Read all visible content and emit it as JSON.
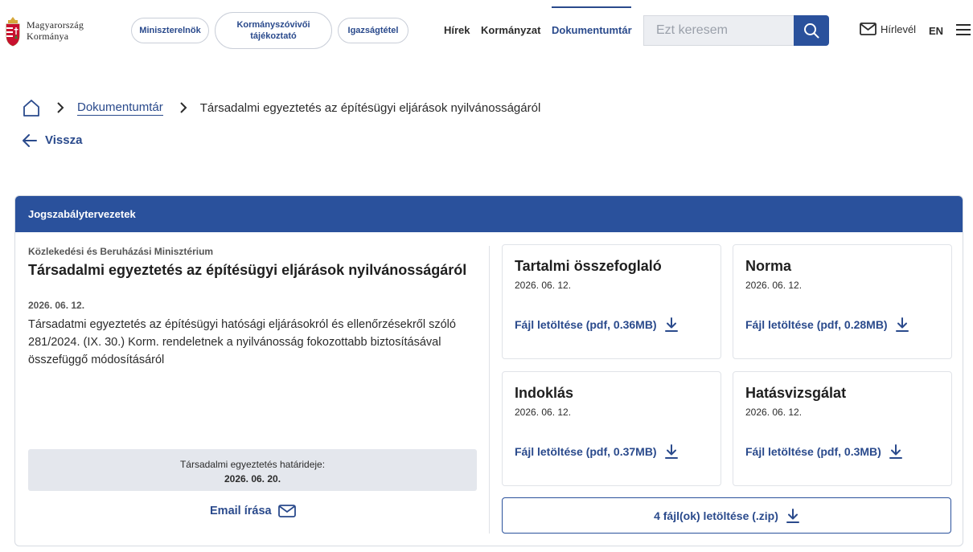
{
  "header": {
    "logo": {
      "line1": "Magyarország",
      "line2": "Kormánya"
    },
    "pills": [
      "Miniszterelnök",
      "Kormányszóvivői tájékoztató",
      "Igazságtétel"
    ],
    "nav": [
      "Hírek",
      "Kormányzat",
      "Dokumentumtár"
    ],
    "active_nav": "Dokumentumtár",
    "search": {
      "placeholder": "Ezt keresem"
    },
    "newsletter": "Hírlevél",
    "lang": "EN"
  },
  "breadcrumb": {
    "items": [
      "Dokumentumtár",
      "Társadalmi egyeztetés az építésügyi eljárások nyilvánosságáról"
    ]
  },
  "back_label": "Vissza",
  "card": {
    "header": "Jogszabálytervezetek",
    "ministry": "Közlekedési és Beruházási Minisztérium",
    "title": "Társadalmi egyeztetés az építésügyi eljárások nyilvánosságáról",
    "date": "2026. 06. 12.",
    "description": "Társadatmi egyeztetés az építésügyi hatósági eljárásokról és ellenőrzésekről szóló 281/2024. (IX. 30.) Korm. rendeletnek a nyilvánosság fokozottabb biztosításával összefüggő módosításáról",
    "deadline_label": "Társadalmi egyeztetés határideje:",
    "deadline_value": "2026. 06. 20.",
    "email_label": "Email írása",
    "files": [
      {
        "title": "Tartalmi összefoglaló",
        "date": "2026. 06. 12.",
        "link": "Fájl letöltése (pdf, 0.36MB)"
      },
      {
        "title": "Norma",
        "date": "2026. 06. 12.",
        "link": "Fájl letöltése (pdf, 0.28MB)"
      },
      {
        "title": "Indoklás",
        "date": "2026. 06. 12.",
        "link": "Fájl letöltése (pdf, 0.37MB)"
      },
      {
        "title": "Hatásvizsgálat",
        "date": "2026. 06. 12.",
        "link": "Fájl letöltése (pdf, 0.3MB)"
      }
    ],
    "zip_label": "4 fájl(ok) letöltése (.zip)"
  },
  "colors": {
    "brand_blue": "#2a519c",
    "link_blue": "#2a4a8c",
    "crest_red": "#c8102e",
    "crest_green": "#3a7d3a"
  },
  "icons": [
    "crest-icon",
    "search-icon",
    "envelope-icon",
    "hamburger-icon",
    "home-icon",
    "chevron-right-icon",
    "arrow-left-icon",
    "download-icon"
  ]
}
